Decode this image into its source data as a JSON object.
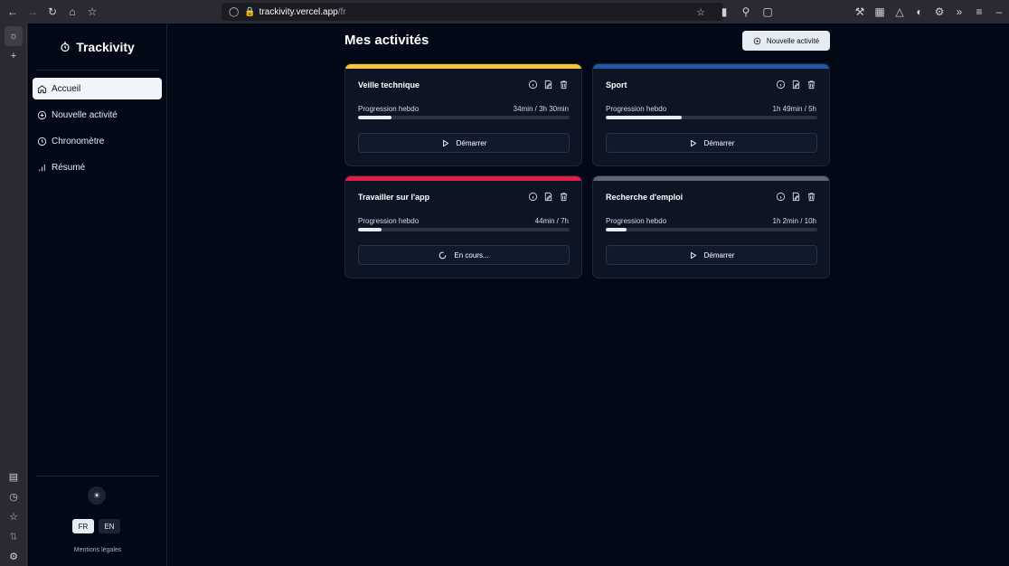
{
  "browser": {
    "url_host": "trackivity.vercel.app",
    "url_path": "/fr"
  },
  "app": {
    "name": "Trackivity",
    "menu": [
      {
        "label": "Accueil",
        "icon": "home-icon",
        "active": true
      },
      {
        "label": "Nouvelle activité",
        "icon": "plus-circle-icon",
        "active": false
      },
      {
        "label": "Chronomètre",
        "icon": "clock-icon",
        "active": false
      },
      {
        "label": "Résumé",
        "icon": "bar-chart-icon",
        "active": false
      }
    ],
    "languages": [
      "FR",
      "EN"
    ],
    "selected_language": "FR",
    "legal": "Mentions légales"
  },
  "main": {
    "title": "Mes activités",
    "new_button": "Nouvelle activité",
    "progress_label": "Progression hebdo",
    "activities": [
      {
        "name": "Veille technique",
        "color": "#f7c63b",
        "progress": "34min /  3h 30min",
        "fraction": 0.16,
        "action": "Démarrer",
        "action_icon": "play-icon"
      },
      {
        "name": "Sport",
        "color": "#2456a6",
        "progress": "1h 49min /  5h",
        "fraction": 0.36,
        "action": "Démarrer",
        "action_icon": "play-icon"
      },
      {
        "name": "Travailler sur l'app",
        "color": "#e11d48",
        "progress": "44min /  7h",
        "fraction": 0.11,
        "action": "En cours...",
        "action_icon": "spinner-icon"
      },
      {
        "name": "Recherche d'emploi",
        "color": "#5f6472",
        "progress": "1h 2min /  10h",
        "fraction": 0.1,
        "action": "Démarrer",
        "action_icon": "play-icon"
      }
    ]
  }
}
